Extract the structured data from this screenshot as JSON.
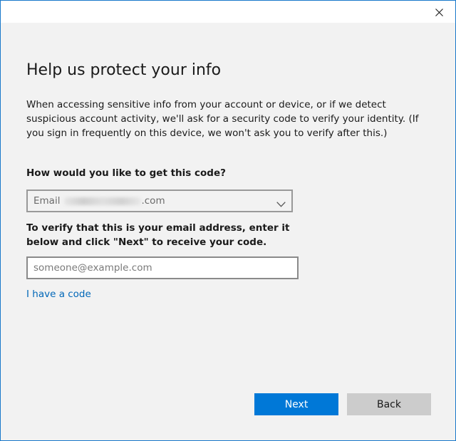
{
  "title": "Help us protect your info",
  "description": "When accessing sensitive info from your account or device, or if we detect suspicious account activity, we'll ask for a security code to verify your identity. (If you sign in frequently on this device, we won't ask you to verify after this.)",
  "method": {
    "label": "How would you like to get this code?",
    "selected_prefix": "Email",
    "selected_suffix": ".com"
  },
  "verify": {
    "label": "To verify that this is your email address, enter it below and click \"Next\" to receive your code.",
    "input_value": "",
    "input_placeholder": "someone@example.com"
  },
  "have_code_link": "I have a code",
  "buttons": {
    "next": "Next",
    "back": "Back"
  },
  "colors": {
    "window_border": "#1979ca",
    "accent": "#0078d7",
    "link": "#0067b8",
    "background": "#f2f2f2",
    "secondary_button": "#cccccc"
  },
  "icons": {
    "close": "close-icon",
    "dropdown": "chevron-down-icon"
  }
}
